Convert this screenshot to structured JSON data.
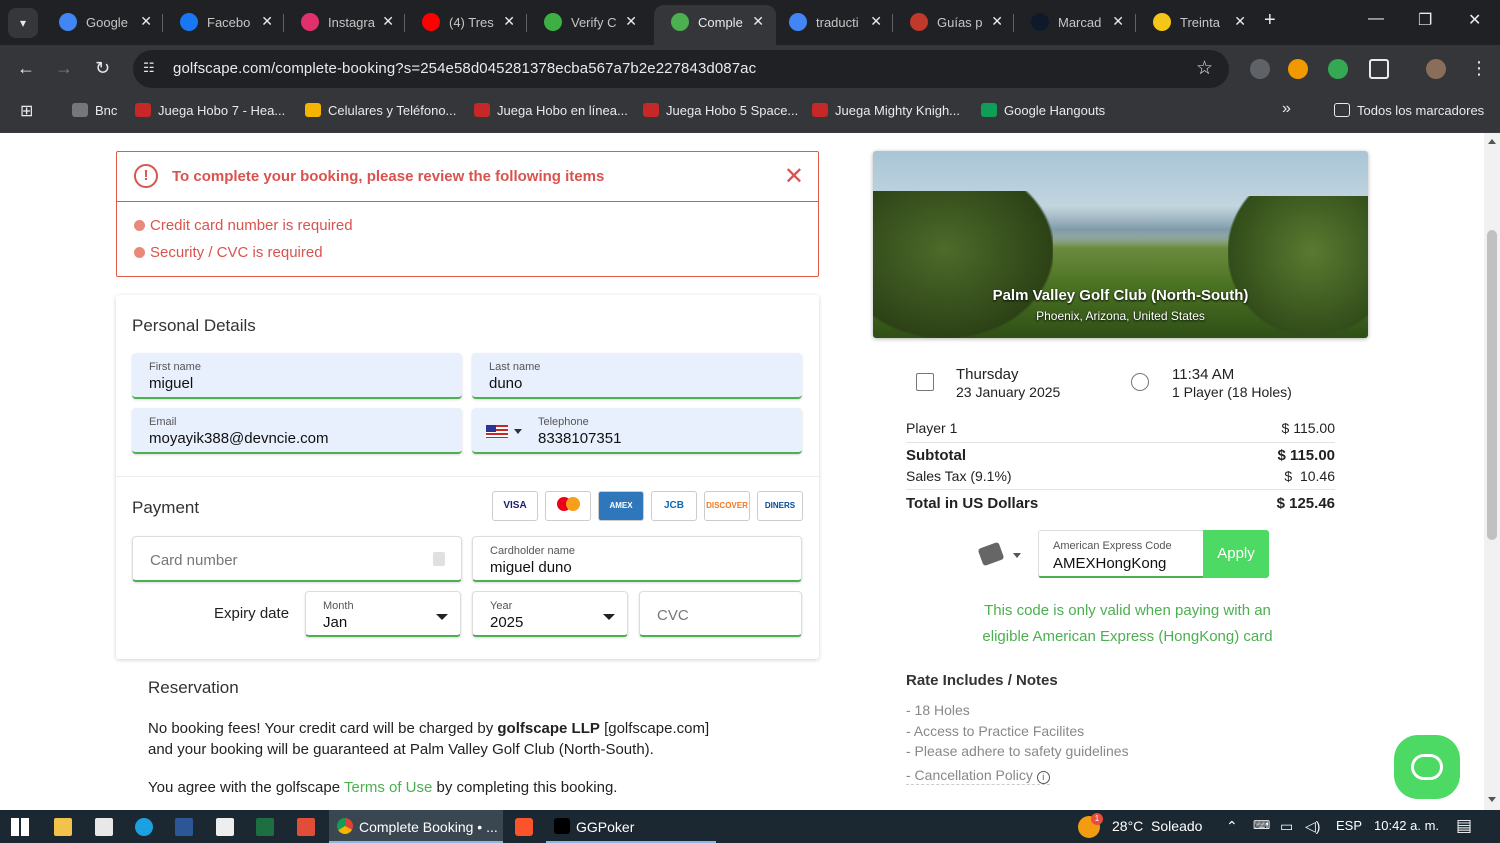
{
  "browser": {
    "tabs": [
      {
        "title": "Google",
        "color": "#4285f4"
      },
      {
        "title": "Facebo",
        "color": "#1877f2"
      },
      {
        "title": "Instagra",
        "color": "#e1306c"
      },
      {
        "title": "(4) Tres",
        "color": "#ff0000"
      },
      {
        "title": "Verify C",
        "color": "#3cb043"
      },
      {
        "title": "Comple",
        "color": "#4caf50"
      },
      {
        "title": "traducti",
        "color": "#4285f4"
      },
      {
        "title": "Guías p",
        "color": "#c0392b"
      },
      {
        "title": "Marcad",
        "color": "#0e1a2b"
      },
      {
        "title": "Treinta",
        "color": "#f5c518"
      }
    ],
    "url": "golfscape.com/complete-booking?s=254e58d045281378ecba567a7b2e227843d087ac",
    "bookmarks": [
      "Bnc",
      "Juega Hobo 7 - Hea...",
      "Celulares y Teléfono...",
      "Juega Hobo en línea...",
      "Juega Hobo 5 Space...",
      "Juega Mighty Knigh...",
      "Google Hangouts"
    ],
    "bookmarks_more": "»",
    "all_bookmarks": "Todos los marcadores"
  },
  "alert": {
    "title": "To complete your booking, please review the following items",
    "items": [
      "Credit card number is required",
      "Security / CVC is required"
    ]
  },
  "personal": {
    "title": "Personal Details",
    "first_name_label": "First name",
    "first_name": "miguel",
    "last_name_label": "Last name",
    "last_name": "duno",
    "email_label": "Email",
    "email": "moyayik388@devncie.com",
    "phone_label": "Telephone",
    "phone": "8338107351"
  },
  "payment": {
    "title": "Payment",
    "card_logos": [
      "VISA",
      "MC",
      "AMEX",
      "JCB",
      "DISCOVER",
      "DINERS"
    ],
    "card_number_ph": "Card number",
    "cardholder_label": "Cardholder name",
    "cardholder": "miguel duno",
    "expiry_label": "Expiry date",
    "month_label": "Month",
    "month": "Jan",
    "year_label": "Year",
    "year": "2025",
    "cvc_ph": "CVC"
  },
  "reservation": {
    "title": "Reservation",
    "line1a": "No booking fees! Your credit card will be charged by ",
    "line1b": "golfscape LLP",
    "line1c": " [golfscape.com]",
    "line2": "and your booking will be guaranteed at Palm Valley Golf Club (North-South).",
    "line3a": "You agree with the golfscape ",
    "line3b": "Terms of Use",
    "line3c": " by completing this booking."
  },
  "course": {
    "name": "Palm Valley Golf Club (North-South)",
    "location": "Phoenix, Arizona, United States"
  },
  "booking": {
    "day": "Thursday",
    "date": "23 January 2025",
    "time": "11:34 AM",
    "players": "1 Player (18 Holes)"
  },
  "summary": {
    "player_label": "Player 1",
    "player_price": "$ 115.00",
    "subtotal_label": "Subtotal",
    "subtotal": "$ 115.00",
    "tax_label": "Sales Tax (9.1%)",
    "tax": "$  10.46",
    "total_label": "Total in US Dollars",
    "total": "$ 125.46"
  },
  "promo": {
    "label": "American Express Code",
    "value": "AMEXHongKong",
    "apply": "Apply",
    "msg1": "This code is only valid when paying with an",
    "msg2": "eligible American Express (HongKong) card"
  },
  "notes": {
    "title": "Rate Includes / Notes",
    "items": [
      "- 18 Holes",
      "- Access to Practice Facilites",
      "- Please adhere to safety guidelines",
      "- Cancellation Policy"
    ]
  },
  "taskbar": {
    "app1": "Complete Booking • ...",
    "app2": "GGPoker",
    "badge": "1",
    "weather": "28°C  Soleado",
    "lang": "ESP",
    "clock": "10:42 a. m."
  }
}
